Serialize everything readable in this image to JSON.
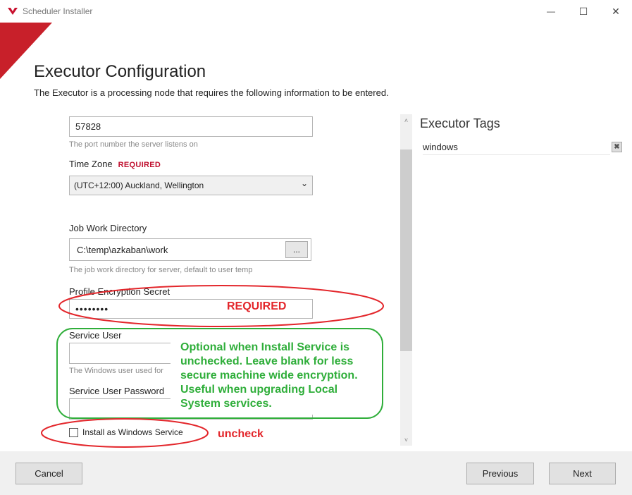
{
  "window": {
    "title": "Scheduler Installer",
    "minimize_glyph": "—",
    "maximize_glyph": "☐",
    "close_glyph": "✕",
    "accent": "#c8102e"
  },
  "header": {
    "title": "Executor Configuration",
    "subtitle": "The Executor is a processing node that requires the following information to be entered."
  },
  "form": {
    "port": {
      "value": "57828",
      "hint": "The port number the server listens on"
    },
    "time_zone": {
      "label": "Time Zone",
      "required": "REQUIRED",
      "value": "(UTC+12:00) Auckland, Wellington",
      "chevron": "⌄"
    },
    "job_work_dir": {
      "label": "Job Work Directory",
      "value": "C:\\temp\\azkaban\\work",
      "browse_label": "...",
      "hint": "The job work directory for server, default to user temp"
    },
    "profile_secret": {
      "label": "Profile Encryption Secret",
      "value": "••••••••"
    },
    "service_user": {
      "label": "Service User",
      "value": "",
      "hint": "The Windows user used for"
    },
    "service_password": {
      "label": "Service User Password",
      "value": ""
    },
    "install_service": {
      "label": "Install as Windows Service",
      "checked": false
    }
  },
  "annotations": {
    "required": "REQUIRED",
    "optional_note": "Optional when Install Service is unchecked. Leave blank for less secure machine wide encryption. Useful when upgrading Local System services.",
    "uncheck": "uncheck",
    "red": "#e3262b",
    "green": "#2fae3a"
  },
  "tags": {
    "title": "Executor Tags",
    "items": [
      {
        "label": "windows",
        "remove_glyph": "✖"
      }
    ]
  },
  "scroll": {
    "up_glyph": "˄",
    "down_glyph": "˅"
  },
  "footer": {
    "cancel_label": "Cancel",
    "previous_label": "Previous",
    "next_label": "Next"
  }
}
